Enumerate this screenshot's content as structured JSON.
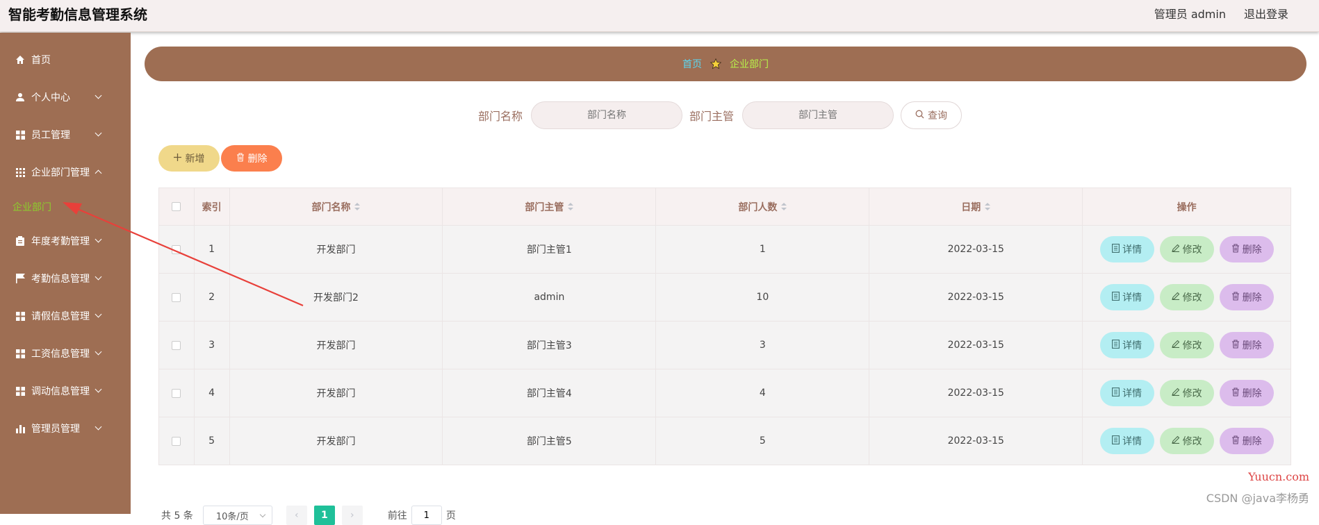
{
  "app_title": "智能考勤信息管理系统",
  "header": {
    "user": "管理员 admin",
    "logout": "退出登录"
  },
  "sidebar": {
    "items": [
      {
        "label": "首页",
        "icon": "home-icon",
        "expandable": false
      },
      {
        "label": "个人中心",
        "icon": "user-icon",
        "expandable": true
      },
      {
        "label": "员工管理",
        "icon": "grid-icon",
        "expandable": true
      },
      {
        "label": "企业部门管理",
        "icon": "apps-icon",
        "expandable": true
      },
      {
        "label": "年度考勤管理",
        "icon": "clipboard-icon",
        "expandable": true
      },
      {
        "label": "考勤信息管理",
        "icon": "flag-icon",
        "expandable": true
      },
      {
        "label": "请假信息管理",
        "icon": "grid-icon",
        "expandable": true
      },
      {
        "label": "工资信息管理",
        "icon": "grid-icon",
        "expandable": true
      },
      {
        "label": "调动信息管理",
        "icon": "grid-icon",
        "expandable": true
      },
      {
        "label": "管理员管理",
        "icon": "bar-chart-icon",
        "expandable": true
      }
    ],
    "active_submenu": "企业部门"
  },
  "breadcrumb": {
    "home": "首页",
    "current": "企业部门"
  },
  "search": {
    "dept_label": "部门名称",
    "dept_placeholder": "部门名称",
    "manager_label": "部门主管",
    "manager_placeholder": "部门主管",
    "query_button": "查询"
  },
  "actions": {
    "add": "新增",
    "delete": "删除"
  },
  "table": {
    "headers": [
      "索引",
      "部门名称",
      "部门主管",
      "部门人数",
      "日期",
      "操作"
    ],
    "rows": [
      {
        "index": "1",
        "name": "开发部门",
        "manager": "部门主管1",
        "count": "1",
        "date": "2022-03-15"
      },
      {
        "index": "2",
        "name": "开发部门2",
        "manager": "admin",
        "count": "10",
        "date": "2022-03-15"
      },
      {
        "index": "3",
        "name": "开发部门",
        "manager": "部门主管3",
        "count": "3",
        "date": "2022-03-15"
      },
      {
        "index": "4",
        "name": "开发部门",
        "manager": "部门主管4",
        "count": "4",
        "date": "2022-03-15"
      },
      {
        "index": "5",
        "name": "开发部门",
        "manager": "部门主管5",
        "count": "5",
        "date": "2022-03-15"
      }
    ],
    "row_actions": {
      "detail": "详情",
      "edit": "修改",
      "delete": "删除"
    }
  },
  "pagination": {
    "total": "共 5 条",
    "page_size": "10条/页",
    "current": "1",
    "goto_prefix": "前往",
    "goto_value": "1",
    "goto_suffix": "页"
  },
  "watermark": {
    "site": "Yuucn.com",
    "credit": "CSDN @java李杨勇"
  },
  "colors": {
    "sidebar": "#9e6e53",
    "accent_green": "#8ccf2c",
    "annotation_arrow": "#e8403a"
  }
}
